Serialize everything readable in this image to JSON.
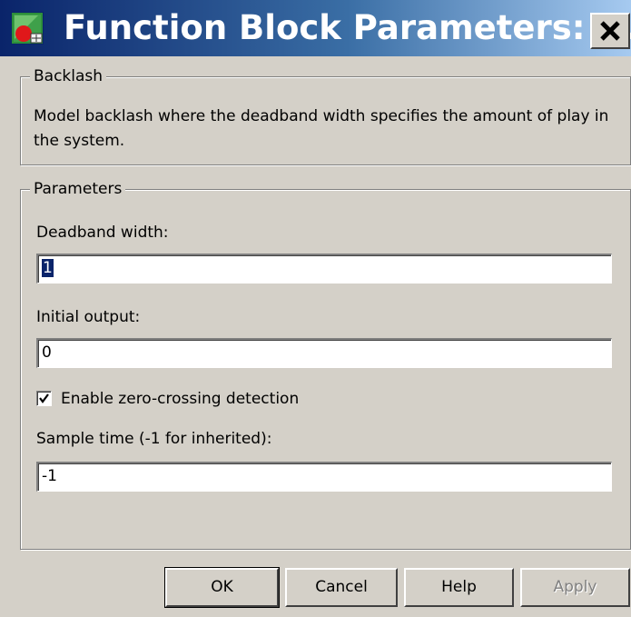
{
  "window": {
    "title": "Function Block Parameters: ...",
    "close_icon": "close-icon",
    "app_icon": "simulink-block-icon"
  },
  "backlash_group": {
    "title": "Backlash",
    "description": "Model backlash where the deadband width specifies the amount of play in the system."
  },
  "parameters_group": {
    "title": "Parameters",
    "deadband_width": {
      "label": "Deadband width:",
      "value": "1"
    },
    "initial_output": {
      "label": "Initial output:",
      "value": "0"
    },
    "zero_crossing": {
      "label": "Enable zero-crossing detection",
      "checked": true
    },
    "sample_time": {
      "label": "Sample time (-1 for inherited):",
      "value": "-1"
    }
  },
  "buttons": {
    "ok": "OK",
    "cancel": "Cancel",
    "help": "Help",
    "apply": "Apply"
  }
}
